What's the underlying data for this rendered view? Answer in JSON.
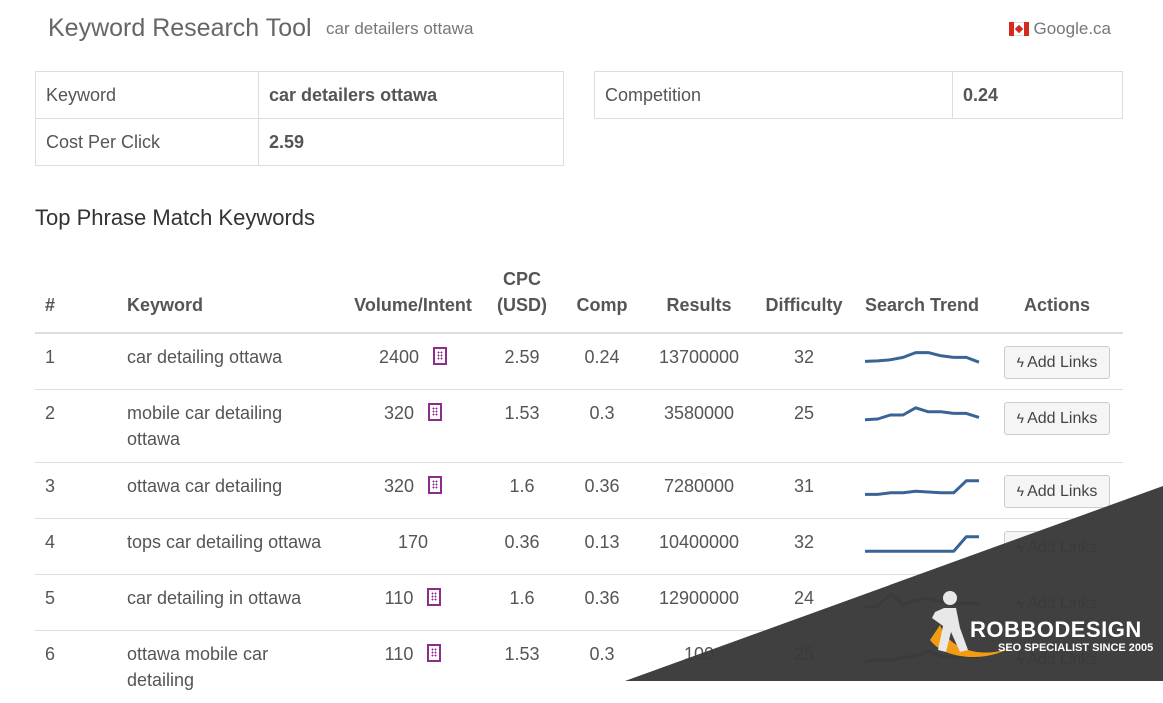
{
  "header": {
    "title": "Keyword Research Tool",
    "query": "car detailers ottawa",
    "engine": "Google.ca"
  },
  "summary": {
    "keyword_label": "Keyword",
    "keyword_value": "car detailers ottawa",
    "cpc_label": "Cost Per Click",
    "cpc_value": "2.59",
    "competition_label": "Competition",
    "competition_value": "0.24"
  },
  "section_title": "Top Phrase Match Keywords",
  "table": {
    "headers": {
      "num": "#",
      "keyword": "Keyword",
      "volume": "Volume/Intent",
      "cpc_line1": "CPC",
      "cpc_line2": "(USD)",
      "comp": "Comp",
      "results": "Results",
      "difficulty": "Difficulty",
      "trend": "Search Trend",
      "actions": "Actions"
    },
    "button_label": "Add Links",
    "rows": [
      {
        "num": "1",
        "keyword": "car detailing ottawa",
        "volume": "2400",
        "intent": true,
        "cpc": "2.59",
        "comp": "0.24",
        "results": "13700000",
        "difficulty": "32",
        "trend": [
          0.35,
          0.38,
          0.45,
          0.6,
          0.9,
          0.9,
          0.7,
          0.6,
          0.6,
          0.3
        ]
      },
      {
        "num": "2",
        "keyword": "mobile car detailing ottawa",
        "volume": "320",
        "intent": true,
        "cpc": "1.53",
        "comp": "0.3",
        "results": "3580000",
        "difficulty": "25",
        "trend": [
          0.2,
          0.25,
          0.5,
          0.5,
          0.95,
          0.7,
          0.7,
          0.6,
          0.6,
          0.35
        ]
      },
      {
        "num": "3",
        "keyword": "ottawa car detailing",
        "volume": "320",
        "intent": true,
        "cpc": "1.6",
        "comp": "0.36",
        "results": "7280000",
        "difficulty": "31",
        "trend": [
          0.1,
          0.1,
          0.2,
          0.2,
          0.3,
          0.25,
          0.2,
          0.2,
          0.95,
          0.95
        ]
      },
      {
        "num": "4",
        "keyword": "tops car detailing ottawa",
        "volume": "170",
        "intent": false,
        "cpc": "0.36",
        "comp": "0.13",
        "results": "10400000",
        "difficulty": "32",
        "trend": [
          0.05,
          0.05,
          0.05,
          0.05,
          0.05,
          0.05,
          0.05,
          0.05,
          0.95,
          0.95
        ]
      },
      {
        "num": "5",
        "keyword": "car detailing in ottawa",
        "volume": "110",
        "intent": true,
        "cpc": "1.6",
        "comp": "0.36",
        "results": "12900000",
        "difficulty": "24",
        "trend": [
          0.1,
          0.1,
          0.9,
          0.2,
          0.5,
          0.6,
          0.4,
          0.3,
          0.3,
          0.3
        ]
      },
      {
        "num": "6",
        "keyword": "ottawa mobile car detailing",
        "volume": "110",
        "intent": true,
        "cpc": "1.53",
        "comp": "0.3",
        "results": "100",
        "difficulty": "25",
        "trend": [
          0.1,
          0.3,
          0.2,
          0.4,
          0.5,
          0.8,
          0.5,
          0.4,
          0.5,
          0.4
        ]
      }
    ]
  },
  "watermark": {
    "brand": "ROBBODESIGN",
    "tagline": "SEO SPECIALIST SINCE 2005"
  },
  "colors": {
    "trend_line": "#3a6496",
    "intent_icon": "#8e2c8e",
    "overlay": "#3a3a3a",
    "logo_accent": "#f39c12"
  }
}
